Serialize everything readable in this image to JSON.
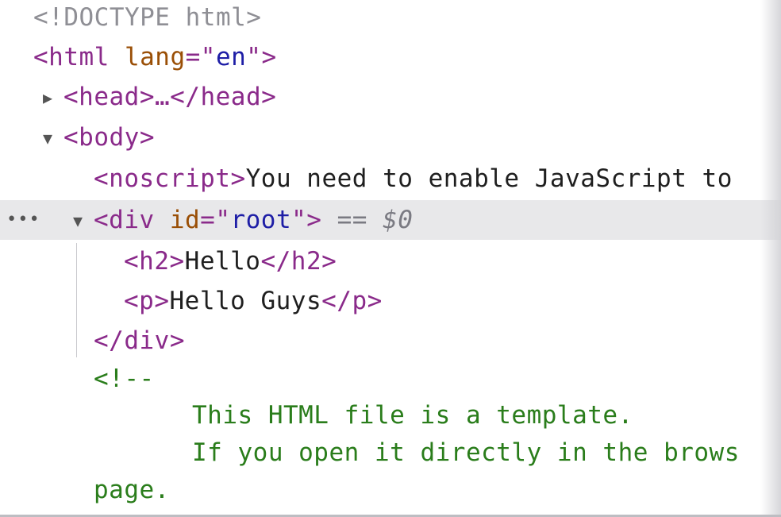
{
  "lines": {
    "doctype": "<!DOCTYPE html>",
    "html_open_lt": "<html ",
    "html_attr": "lang",
    "html_eq": "=\"",
    "html_val": "en",
    "html_close": "\">",
    "head": "<head>…</head>",
    "body": "<body>",
    "noscript_tag": "<noscript>",
    "noscript_text": "You need to enable JavaScript to",
    "div_open": "<div ",
    "div_attr": "id",
    "div_eq": "=\"",
    "div_val": "root",
    "div_close": "\">",
    "div_eq_marker": " == ",
    "div_var": "$0",
    "h2_open": "<h2>",
    "h2_text": "Hello",
    "h2_close": "</h2>",
    "p_open": "<p>",
    "p_text": "Hello Guys",
    "p_close": "</p>",
    "div_end": "</div>",
    "comment_start": "<!--",
    "comment_line1": "This HTML file is a template.",
    "comment_line2": "If you open it directly in the brows",
    "comment_line3": "page."
  },
  "controls": {
    "expand_collapsed": "▶",
    "expand_open": "▼",
    "ellipsis": "•••"
  },
  "colors": {
    "tag": "#8a2a8a",
    "attribute": "#9a4f06",
    "value": "#1e1ea6",
    "comment": "#2a7d1b",
    "selected_row": "#e8e8ea"
  }
}
